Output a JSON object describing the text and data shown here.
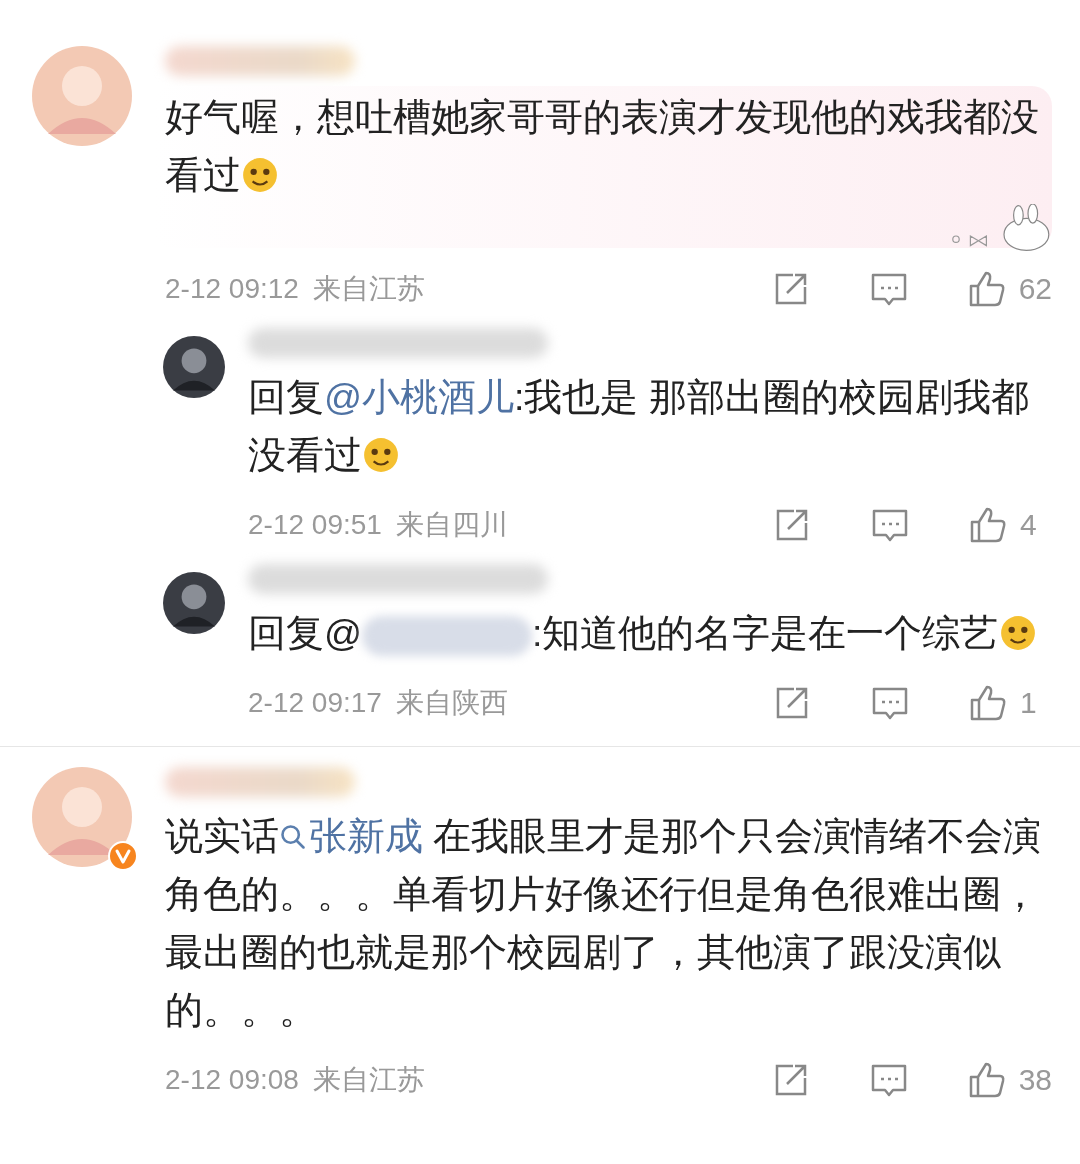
{
  "comments": [
    {
      "kind": "comment",
      "verified": false,
      "decorated_bubble": true,
      "segments": [
        {
          "kind": "text",
          "text": "好气喔，想吐槽她家哥哥的表演才发现他的戏我都没看过"
        },
        {
          "kind": "emoji"
        }
      ],
      "date": "2-12 09:12",
      "location": "来自江苏",
      "likes": "62"
    },
    {
      "kind": "reply",
      "verified": false,
      "decorated_bubble": false,
      "segments": [
        {
          "kind": "text",
          "text": "回复"
        },
        {
          "kind": "mention",
          "text": "@小桃酒儿"
        },
        {
          "kind": "text",
          "text": ":我也是 那部出圈的校园剧我都没看过"
        },
        {
          "kind": "emoji"
        }
      ],
      "date": "2-12 09:51",
      "location": "来自四川",
      "likes": "4"
    },
    {
      "kind": "reply",
      "verified": false,
      "decorated_bubble": false,
      "segments": [
        {
          "kind": "text",
          "text": "回复@"
        },
        {
          "kind": "blurred"
        },
        {
          "kind": "text",
          "text": ":知道他的名字是在一个综艺"
        },
        {
          "kind": "emoji"
        }
      ],
      "date": "2-12 09:17",
      "location": "来自陕西",
      "likes": "1"
    },
    {
      "kind": "comment",
      "verified": true,
      "decorated_bubble": false,
      "segments": [
        {
          "kind": "text",
          "text": "说实话"
        },
        {
          "kind": "topic",
          "text": "张新成"
        },
        {
          "kind": "text",
          "text": " 在我眼里才是那个只会演情绪不会演角色的。。。单看切片好像还行但是角色很难出圈，最出圈的也就是那个校园剧了，其他演了跟没演似的。。。"
        }
      ],
      "date": "2-12 09:08",
      "location": "来自江苏",
      "likes": "38"
    }
  ]
}
